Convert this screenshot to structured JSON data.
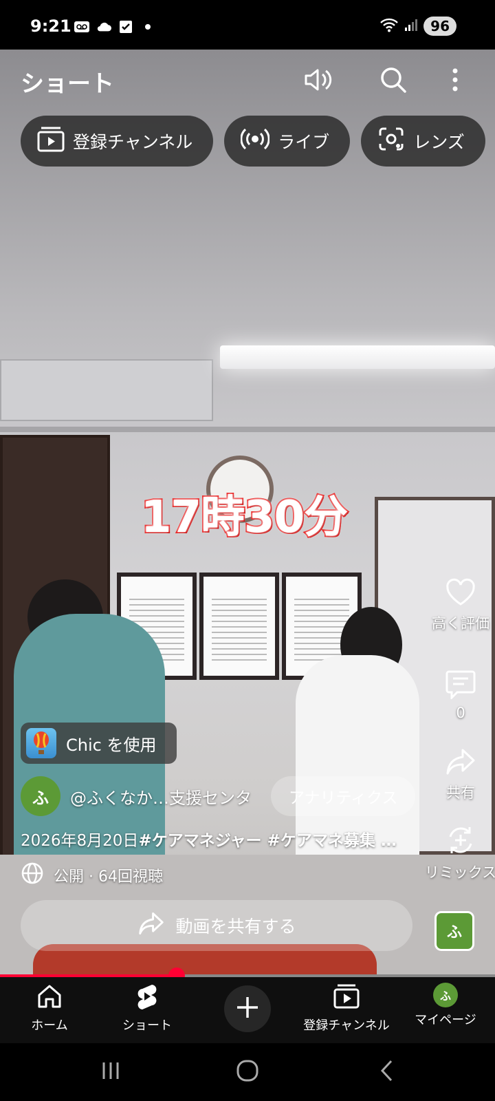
{
  "status_bar": {
    "time": "9:21",
    "battery": "96",
    "icons_left": [
      "voicemail-icon",
      "cloud-icon",
      "check-square-icon",
      "dot-icon"
    ],
    "icons_right": [
      "wifi-icon",
      "signal-icon"
    ]
  },
  "header": {
    "title": "ショート",
    "actions": [
      "volume-icon",
      "search-icon",
      "more-icon"
    ]
  },
  "chips": [
    {
      "label": "登録チャンネル",
      "icon": "subscriptions-icon"
    },
    {
      "label": "ライブ",
      "icon": "live-icon"
    },
    {
      "label": "レンズ",
      "icon": "lens-icon"
    }
  ],
  "video": {
    "overlay_text": "17時30分"
  },
  "rail": {
    "like_label": "高く評価",
    "comment_count": "0",
    "share_label": "共有",
    "remix_label": "リミックス"
  },
  "info": {
    "effect_label": "Chic を使用",
    "channel_initial": "ふ",
    "channel_name": "@ふくなか…支援センタ",
    "analytics_label": "アナリティクス",
    "caption_date": "2026年8月20日",
    "caption_tags": "#ケアマネジャー #ケアマネ募集 …",
    "visibility": "公開 · 64回視聴",
    "share_video_label": "動画を共有する",
    "channel_thumb_initial": "ふ"
  },
  "progress": {
    "fraction": 0.357
  },
  "bottom_nav": [
    {
      "label": "ホーム",
      "icon": "home-icon"
    },
    {
      "label": "ショート",
      "icon": "shorts-icon"
    },
    {
      "label": "",
      "icon": "create-icon"
    },
    {
      "label": "登録チャンネル",
      "icon": "subscriptions-icon"
    },
    {
      "label": "マイページ",
      "icon": "avatar"
    }
  ],
  "my_avatar_initial": "ふ",
  "colors": {
    "accent": "#ff0033",
    "avatar_green": "#5c9a36",
    "overlay_stroke": "#e81b1b"
  }
}
